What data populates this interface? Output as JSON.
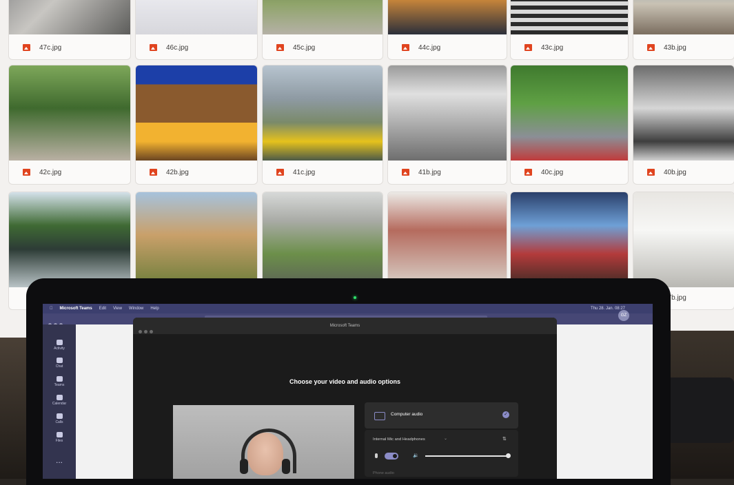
{
  "grid": {
    "files": [
      {
        "name": "47c.jpg",
        "row": 0,
        "col": 0,
        "scene": "bridge"
      },
      {
        "name": "46c.jpg",
        "row": 0,
        "col": 1,
        "scene": "poster"
      },
      {
        "name": "45c.jpg",
        "row": 0,
        "col": 2,
        "scene": "path"
      },
      {
        "name": "44c.jpg",
        "row": 0,
        "col": 3,
        "scene": "city-night"
      },
      {
        "name": "43c.jpg",
        "row": 0,
        "col": 4,
        "scene": "stairs"
      },
      {
        "name": "43b.jpg",
        "row": 0,
        "col": 5,
        "scene": "street"
      },
      {
        "name": "42c.jpg",
        "row": 1,
        "col": 0,
        "scene": "trees-street"
      },
      {
        "name": "42b.jpg",
        "row": 1,
        "col": 1,
        "scene": "wood-building"
      },
      {
        "name": "41c.jpg",
        "row": 1,
        "col": 2,
        "scene": "tram-street"
      },
      {
        "name": "41b.jpg",
        "row": 1,
        "col": 3,
        "scene": "bw-building"
      },
      {
        "name": "40c.jpg",
        "row": 1,
        "col": 4,
        "scene": "avenue"
      },
      {
        "name": "40b.jpg",
        "row": 1,
        "col": 5,
        "scene": "town-hall"
      },
      {
        "name": "",
        "row": 2,
        "col": 0,
        "scene": "river-boat"
      },
      {
        "name": "",
        "row": 2,
        "col": 1,
        "scene": "long-building"
      },
      {
        "name": "",
        "row": 2,
        "col": 2,
        "scene": "city-park"
      },
      {
        "name": "",
        "row": 2,
        "col": 3,
        "scene": "winter-trees"
      },
      {
        "name": "",
        "row": 2,
        "col": 4,
        "scene": "bazaar"
      },
      {
        "name": "37b.jpg",
        "row": 2,
        "col": 5,
        "scene": "courtyard"
      }
    ]
  },
  "laptop": {
    "menubar": {
      "app": "Microsoft Teams",
      "menus": [
        "Edit",
        "View",
        "Window",
        "Help"
      ],
      "clock": "Thu 28. Jan. 08:27"
    },
    "avatar_initials": "GZ",
    "rail": [
      "Activity",
      "Chat",
      "Teams",
      "Calendar",
      "Calls",
      "Files"
    ],
    "rail_more": "...",
    "dialog": {
      "window_title": "Microsoft Teams",
      "heading": "Choose your video and audio options",
      "audio_option": "Computer audio",
      "device_label": "Internal Mic and Headphones",
      "volume_level": 0.98,
      "phone_option": "Phone audio"
    }
  },
  "colors": {
    "teams_purple": "#464775",
    "accent": "#8b8cc7",
    "file_icon": "#e0441f",
    "led": "#2ee06a"
  }
}
